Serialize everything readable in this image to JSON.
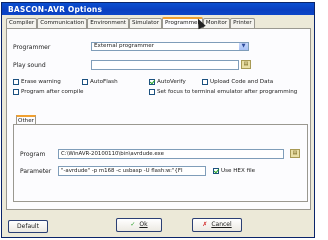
{
  "window": {
    "title": "BASCON-AVR Options"
  },
  "tabs": [
    "Compiler",
    "Communication",
    "Environment",
    "Simulator",
    "Programmer",
    "Monitor",
    "Printer"
  ],
  "active_tab": "Programmer",
  "programmer": {
    "label": "Programmer",
    "value": "External programmer",
    "play_sound_label": "Play sound",
    "play_sound_value": ""
  },
  "options": [
    {
      "label": "Erase warning",
      "checked": false
    },
    {
      "label": "AutoFlash",
      "checked": false
    },
    {
      "label": "AutoVerify",
      "checked": true
    },
    {
      "label": "Upload Code and Data",
      "checked": false
    },
    {
      "label": "Program after compile",
      "checked": false
    },
    {
      "label": "Set focus to terminal emulator after programming",
      "checked": false
    }
  ],
  "other": {
    "tab_label": "Other",
    "program_label": "Program",
    "program_value": "C:\\WinAVR-20100110\\bin\\avrdude.exe",
    "parameter_label": "Parameter",
    "parameter_value": "\"-avrdude\" -p m168 -c usbasp -U flash:w:\"{FI",
    "use_hex_label": "Use HEX file",
    "use_hex_checked": true
  },
  "buttons": {
    "default": "Default",
    "ok": "Ok",
    "cancel": "Cancel"
  },
  "colors": {
    "titlebar": "#0a3fc0",
    "active_tab_accent": "#f0a030"
  }
}
